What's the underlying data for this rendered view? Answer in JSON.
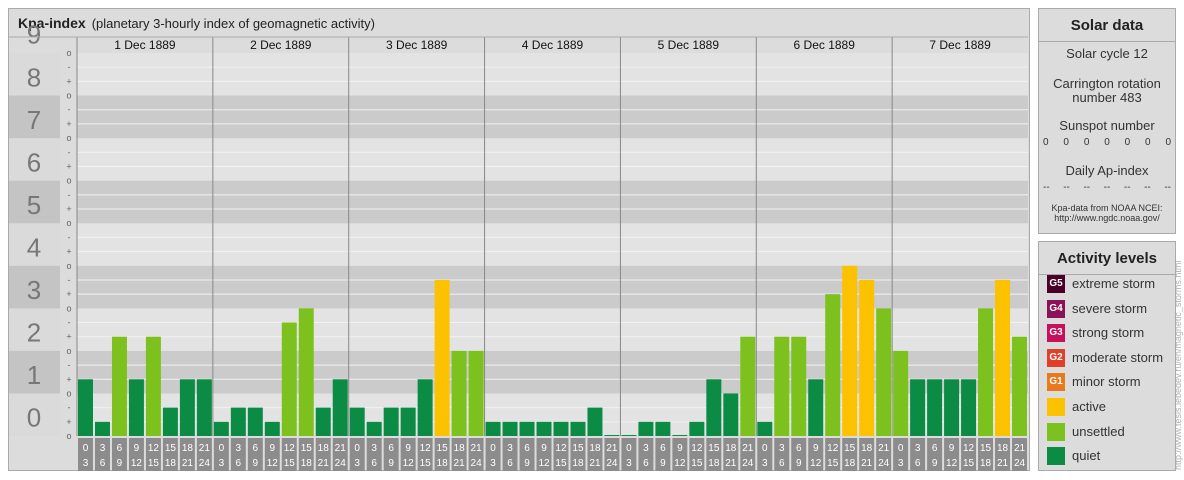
{
  "header": {
    "title": "Kpa-index",
    "subtitle": "(planetary 3-hourly index of geomagnetic activity)"
  },
  "chart_data": {
    "type": "bar",
    "title": "Kpa-index",
    "subtitle": "(planetary 3-hourly index of geomagnetic activity)",
    "ylim": [
      0,
      9
    ],
    "y_ticks": [
      "0",
      "1",
      "2",
      "3",
      "4",
      "5",
      "6",
      "7",
      "8",
      "9"
    ],
    "sub_ticks": [
      "-",
      "o",
      "+"
    ],
    "days": [
      "1 Dec 1889",
      "2 Dec 1889",
      "3 Dec 1889",
      "4 Dec 1889",
      "5 Dec 1889",
      "6 Dec 1889",
      "7 Dec 1889"
    ],
    "interval_start_labels": [
      "0",
      "3",
      "6",
      "9",
      "12",
      "15",
      "18",
      "21"
    ],
    "interval_end_labels": [
      "3",
      "6",
      "9",
      "12",
      "15",
      "18",
      "21",
      "24"
    ],
    "values": [
      [
        1.333,
        0.333,
        2.333,
        1.333,
        2.333,
        0.667,
        1.333,
        1.333
      ],
      [
        0.333,
        0.667,
        0.667,
        0.333,
        2.667,
        3.0,
        0.667,
        1.333
      ],
      [
        0.667,
        0.333,
        0.667,
        0.667,
        1.333,
        3.667,
        2.0,
        2.0
      ],
      [
        0.333,
        0.333,
        0.333,
        0.333,
        0.333,
        0.333,
        0.667,
        0.0
      ],
      [
        0.0,
        0.333,
        0.333,
        0.0,
        0.333,
        1.333,
        1.0,
        2.333
      ],
      [
        0.333,
        2.333,
        2.333,
        1.333,
        3.333,
        4.0,
        3.667,
        3.0
      ],
      [
        2.0,
        1.333,
        1.333,
        1.333,
        1.333,
        3.0,
        3.667,
        2.333
      ]
    ],
    "thresholds": {
      "unsettled_min": 2.0,
      "active_min": 3.5
    },
    "grid": true,
    "legend": "right"
  },
  "solar_data": {
    "title": "Solar data",
    "solar_cycle": "Solar cycle 12",
    "carrington_line1": "Carrington rotation",
    "carrington_line2": "number 483",
    "sunspot_label": "Sunspot number",
    "sunspot_values": [
      "0",
      "0",
      "0",
      "0",
      "0",
      "0",
      "0"
    ],
    "ap_label": "Daily Ap-index",
    "ap_values": [
      "--",
      "--",
      "--",
      "--",
      "--",
      "--",
      "--"
    ],
    "source_line1": "Kpa-data from NOAA NCEI:",
    "source_line2": "http://www.ngdc.noaa.gov/"
  },
  "activity_levels": {
    "title": "Activity levels",
    "items": [
      {
        "code": "G5",
        "label": "extreme storm",
        "color": "#4a0028"
      },
      {
        "code": "G4",
        "label": "severe storm",
        "color": "#8b1158"
      },
      {
        "code": "G3",
        "label": "strong storm",
        "color": "#c7105c"
      },
      {
        "code": "G2",
        "label": "moderate storm",
        "color": "#e0402a"
      },
      {
        "code": "G1",
        "label": "minor storm",
        "color": "#e87a1b"
      },
      {
        "code": "",
        "label": "active",
        "color": "#fcc200"
      },
      {
        "code": "",
        "label": "unsettled",
        "color": "#7dc11f"
      },
      {
        "code": "",
        "label": "quiet",
        "color": "#0b8b44"
      }
    ]
  },
  "watermark": "http://www.tesis.lebedev.ru/en/magnetic_storms.html"
}
